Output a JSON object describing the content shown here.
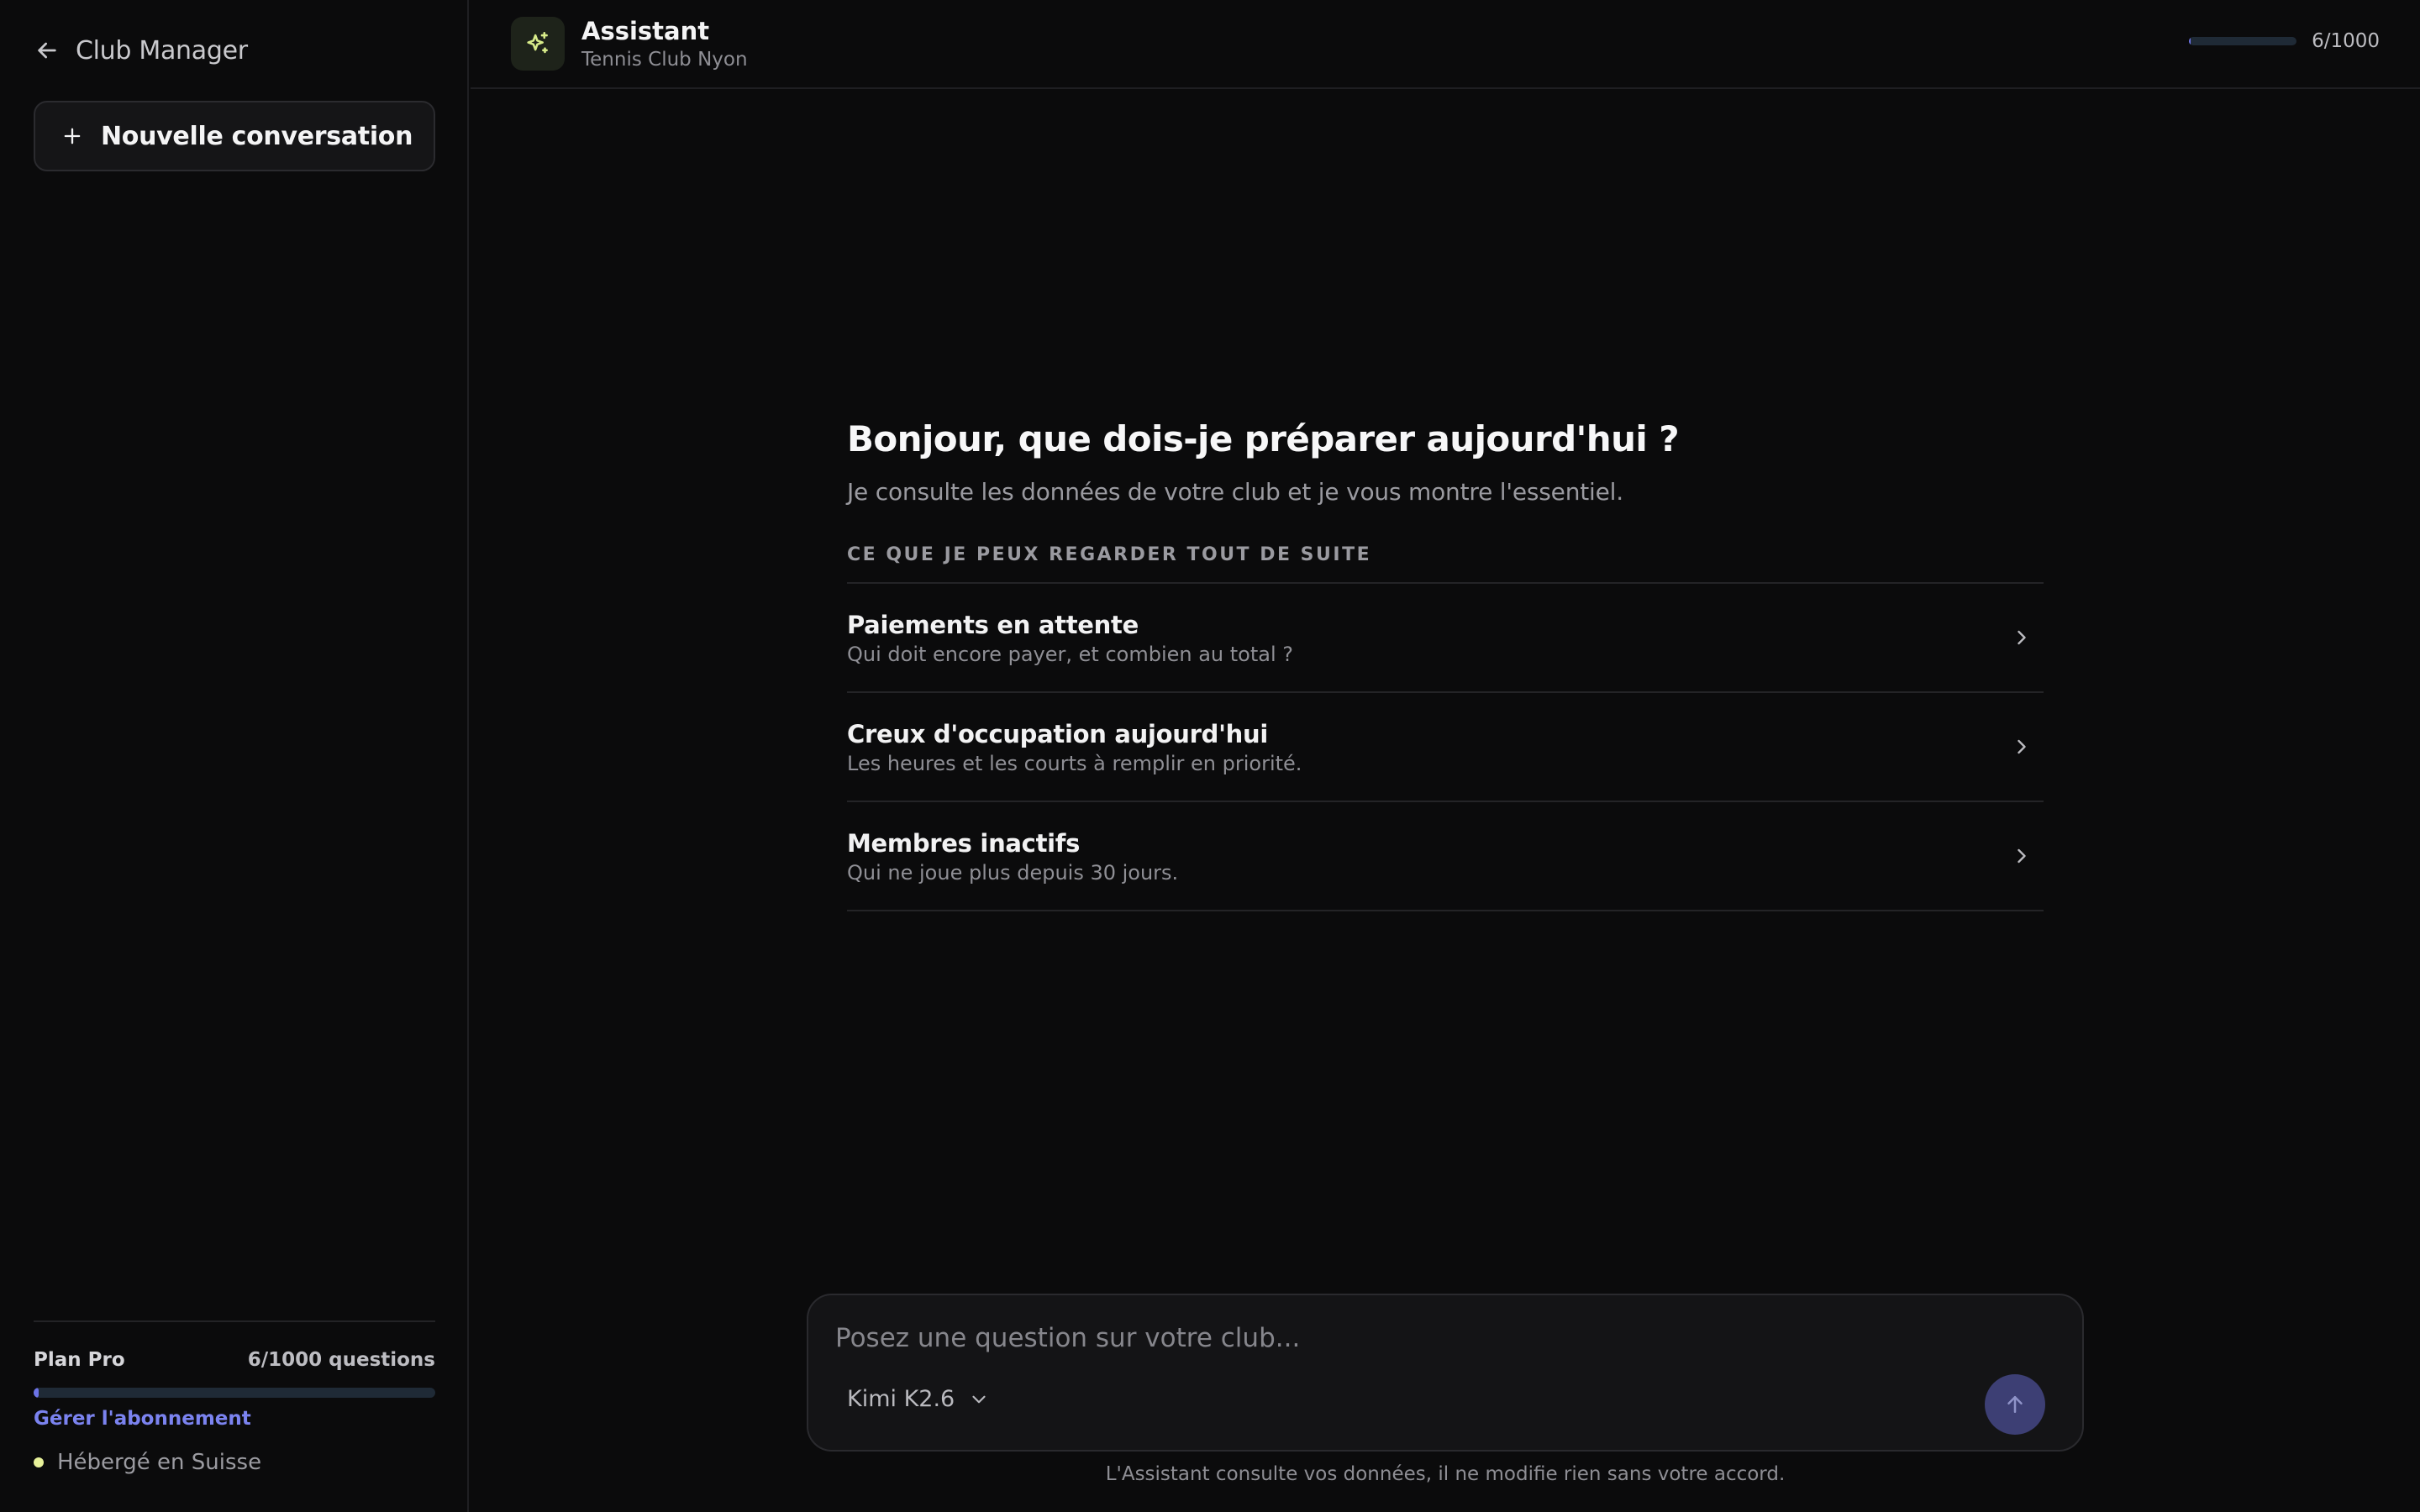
{
  "sidebar": {
    "back_label": "Club Manager",
    "new_conversation_label": "Nouvelle conversation",
    "plan": {
      "name": "Plan Pro",
      "usage_text": "6/1000 questions",
      "usage_fraction": 0.006,
      "manage_link": "Gérer l'abonnement"
    },
    "hosted_label": "Hébergé en Suisse"
  },
  "header": {
    "title": "Assistant",
    "subtitle": "Tennis Club Nyon",
    "usage_text": "6/1000",
    "usage_fraction": 0.006
  },
  "welcome": {
    "greeting": "Bonjour, que dois-je préparer aujourd'hui ?",
    "intro": "Je consulte les données de votre club et je vous montre l'essentiel.",
    "section_label": "CE QUE JE PEUX REGARDER TOUT DE SUITE",
    "suggestions": [
      {
        "title": "Paiements en attente",
        "description": "Qui doit encore payer, et combien au total ?"
      },
      {
        "title": "Creux d'occupation aujourd'hui",
        "description": "Les heures et les courts à remplir en priorité."
      },
      {
        "title": "Membres inactifs",
        "description": "Qui ne joue plus depuis 30 jours."
      }
    ]
  },
  "composer": {
    "placeholder": "Posez une question sur votre club...",
    "value": "",
    "model_label": "Kimi K2.6"
  },
  "disclaimer": "L'Assistant consulte vos données, il ne modifie rien sans votre accord.",
  "colors": {
    "background": "#0b0b0c",
    "accent": "#6d74e8",
    "link": "#7b83f0",
    "badge_icon": "#d8ec8a",
    "send_button": "#3d3f74"
  },
  "icons": {
    "back": "arrow-left-icon",
    "new": "plus-icon",
    "assistant": "sparkles-icon",
    "chevron": "chevron-right-icon",
    "model_dropdown": "chevron-down-icon",
    "send": "arrow-up-icon",
    "hosted": "status-dot-icon"
  }
}
